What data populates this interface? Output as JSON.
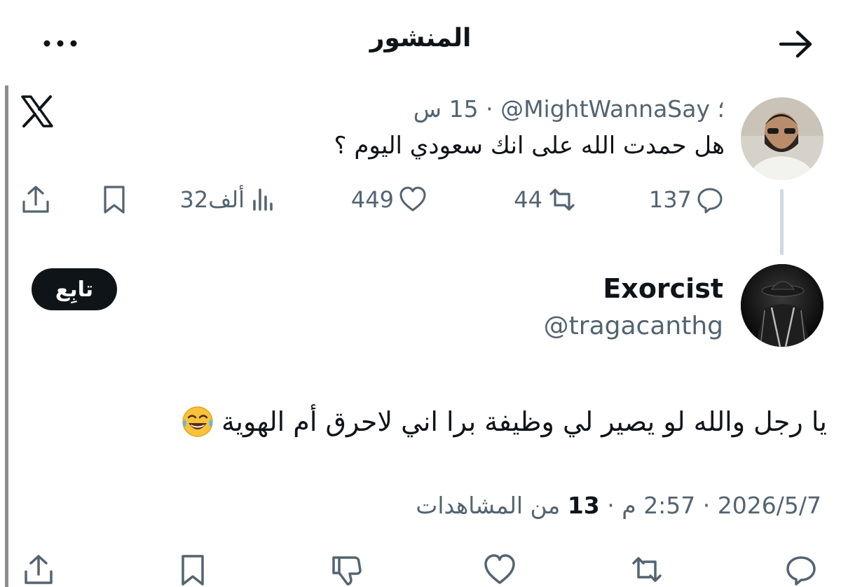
{
  "header": {
    "title": "المنشور",
    "back_icon": "arrow-right-icon",
    "more_icon": "more-dots-icon"
  },
  "parent_tweet": {
    "separator": "؛",
    "handle": "@MightWannaSay",
    "time": "15 س",
    "text": "هل حمدت الله على انك سعودي اليوم ؟",
    "replies": "137",
    "retweets": "44",
    "likes": "449",
    "views": "32ألف"
  },
  "main_tweet": {
    "name": "Exorcist",
    "handle": "@tragacanthg",
    "follow_label": "تابِع",
    "text": "يا رجل والله لو يصير لي وظيفة برا اني لاحرق أم الهوية",
    "emoji": "face-with-tears-of-joy-icon",
    "date": "2026/5/7",
    "time": "2:57 م",
    "views_count": "13",
    "views_label": "من المشاهدات"
  },
  "colors": {
    "text": "#0f1419",
    "muted": "#536471",
    "follow_bg": "#0f1419",
    "divider": "#cfd9de"
  }
}
